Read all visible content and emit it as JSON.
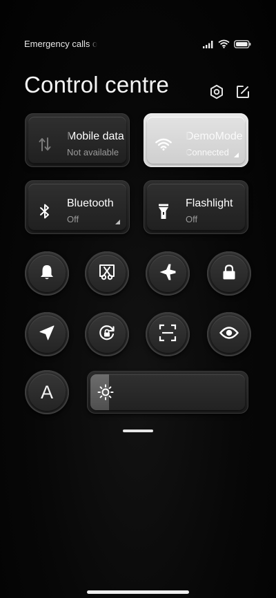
{
  "status_bar": {
    "carrier_text": "Emergency calls o",
    "icons": [
      "signal-icon",
      "wifi-icon",
      "battery-icon"
    ]
  },
  "header": {
    "title": "Control centre",
    "icons": [
      "settings-icon",
      "edit-icon"
    ]
  },
  "tiles": [
    {
      "id": "mobile-data",
      "label": "Mobile data",
      "status": "Not available",
      "icon": "mobile-data-icon",
      "active": false
    },
    {
      "id": "wifi",
      "label": "DemoMode",
      "status": "Connected",
      "icon": "wifi-icon",
      "active": true
    },
    {
      "id": "bluetooth",
      "label": "Bluetooth",
      "status": "Off",
      "icon": "bluetooth-icon",
      "active": false
    },
    {
      "id": "flashlight",
      "label": "Flashlight",
      "status": "Off",
      "icon": "flashlight-icon",
      "active": false
    }
  ],
  "round_toggles": [
    {
      "name": "mute-toggle",
      "icon": "bell-icon"
    },
    {
      "name": "screenshot-toggle",
      "icon": "screenshot-icon"
    },
    {
      "name": "airplane-mode-toggle",
      "icon": "airplane-icon"
    },
    {
      "name": "lock-screen-toggle",
      "icon": "lock-icon"
    },
    {
      "name": "location-toggle",
      "icon": "location-icon"
    },
    {
      "name": "rotation-lock-toggle",
      "icon": "rotation-lock-icon"
    },
    {
      "name": "scanner-toggle",
      "icon": "scan-icon"
    },
    {
      "name": "reading-mode-toggle",
      "icon": "eye-icon"
    },
    {
      "name": "auto-brightness-toggle",
      "icon": "letter-a-icon",
      "glyph": "A"
    }
  ],
  "brightness": {
    "icon": "sun-icon",
    "level_fraction": 0.12
  },
  "colors": {
    "background": "#070707",
    "tile": "#262626",
    "tile_active": "#dedede",
    "text_secondary": "#9a9a9a"
  }
}
